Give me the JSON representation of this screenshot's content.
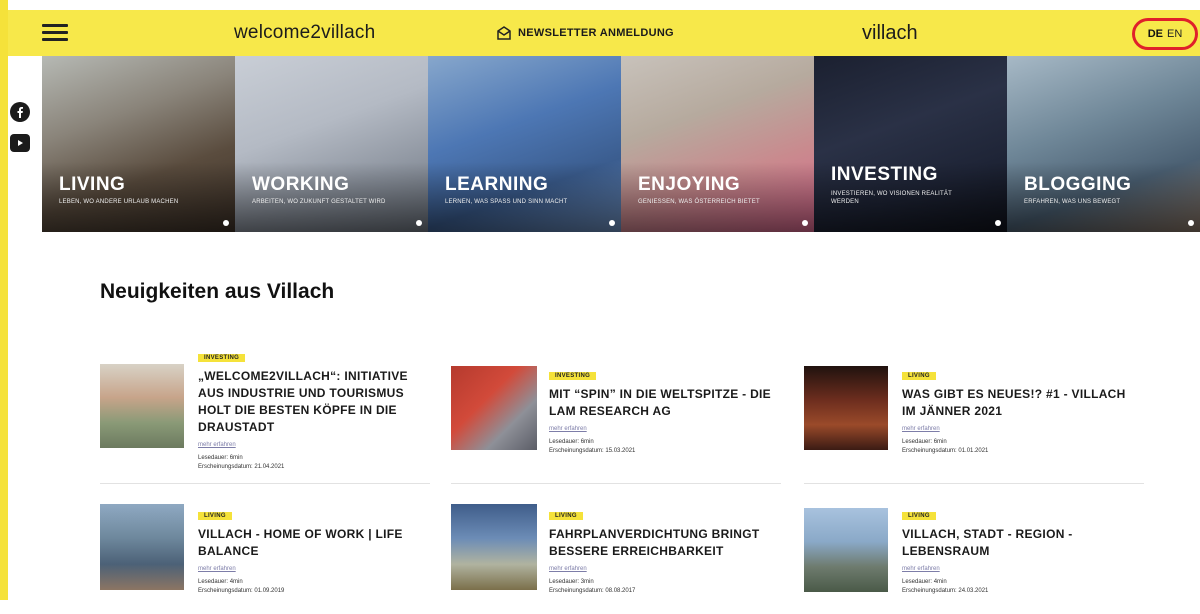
{
  "header": {
    "brand": "welcome2villach",
    "newsletter_label": "NEWSLETTER ANMELDUNG",
    "city": "villach",
    "lang_de": "DE",
    "lang_en": "EN"
  },
  "hero": [
    {
      "title": "LIVING",
      "subtitle": "LEBEN, WO ANDERE URLAUB MACHEN"
    },
    {
      "title": "WORKING",
      "subtitle": "ARBEITEN, WO ZUKUNFT GESTALTET WIRD"
    },
    {
      "title": "LEARNING",
      "subtitle": "LERNEN, WAS SPASS UND SINN MACHT"
    },
    {
      "title": "ENJOYING",
      "subtitle": "GENIESSEN, WAS ÖSTERREICH BIETET"
    },
    {
      "title": "INVESTING",
      "subtitle": "INVESTIEREN, WO VISIONEN REALITÄT WERDEN"
    },
    {
      "title": "BLOGGING",
      "subtitle": "ERFAHREN, WAS UNS BEWEGT"
    }
  ],
  "news": {
    "title": "Neuigkeiten aus Villach",
    "items": [
      {
        "tag": "INVESTING",
        "headline": "„WELCOME2VILLACH“: INITIATIVE AUS INDUSTRIE UND TOURISMUS HOLT DIE BESTEN KÖPFE IN DIE DRAUSTADT",
        "more": "mehr erfahren",
        "read_time": "Lesedauer: 6min",
        "date": "Erscheinungsdatum: 21.04.2021"
      },
      {
        "tag": "INVESTING",
        "headline": "MIT “SPIN” IN DIE WELTSPITZE - DIE LAM RESEARCH AG",
        "more": "mehr erfahren",
        "read_time": "Lesedauer: 6min",
        "date": "Erscheinungsdatum: 15.03.2021"
      },
      {
        "tag": "LIVING",
        "headline": "WAS GIBT ES NEUES!? #1 - VILLACH IM JÄNNER 2021",
        "more": "mehr erfahren",
        "read_time": "Lesedauer: 6min",
        "date": "Erscheinungsdatum: 01.01.2021"
      },
      {
        "tag": "LIVING",
        "headline": "VILLACH - HOME OF WORK | LIFE BALANCE",
        "more": "mehr erfahren",
        "read_time": "Lesedauer: 4min",
        "date": "Erscheinungsdatum: 01.09.2019"
      },
      {
        "tag": "LIVING",
        "headline": "FAHRPLANVERDICHTUNG BRINGT BESSERE ERREICHBARKEIT",
        "more": "mehr erfahren",
        "read_time": "Lesedauer: 3min",
        "date": "Erscheinungsdatum: 08.08.2017"
      },
      {
        "tag": "LIVING",
        "headline": "VILLACH, STADT - REGION - LEBENSRAUM",
        "more": "mehr erfahren",
        "read_time": "Lesedauer: 4min",
        "date": "Erscheinungsdatum: 24.03.2021"
      }
    ]
  },
  "colors": {
    "brand_yellow": "#f7e84a",
    "tag_yellow": "#f5e23a",
    "highlight_red": "#e0202a"
  },
  "icons": [
    "hamburger-menu-icon",
    "envelope-icon",
    "facebook-icon",
    "youtube-icon"
  ]
}
